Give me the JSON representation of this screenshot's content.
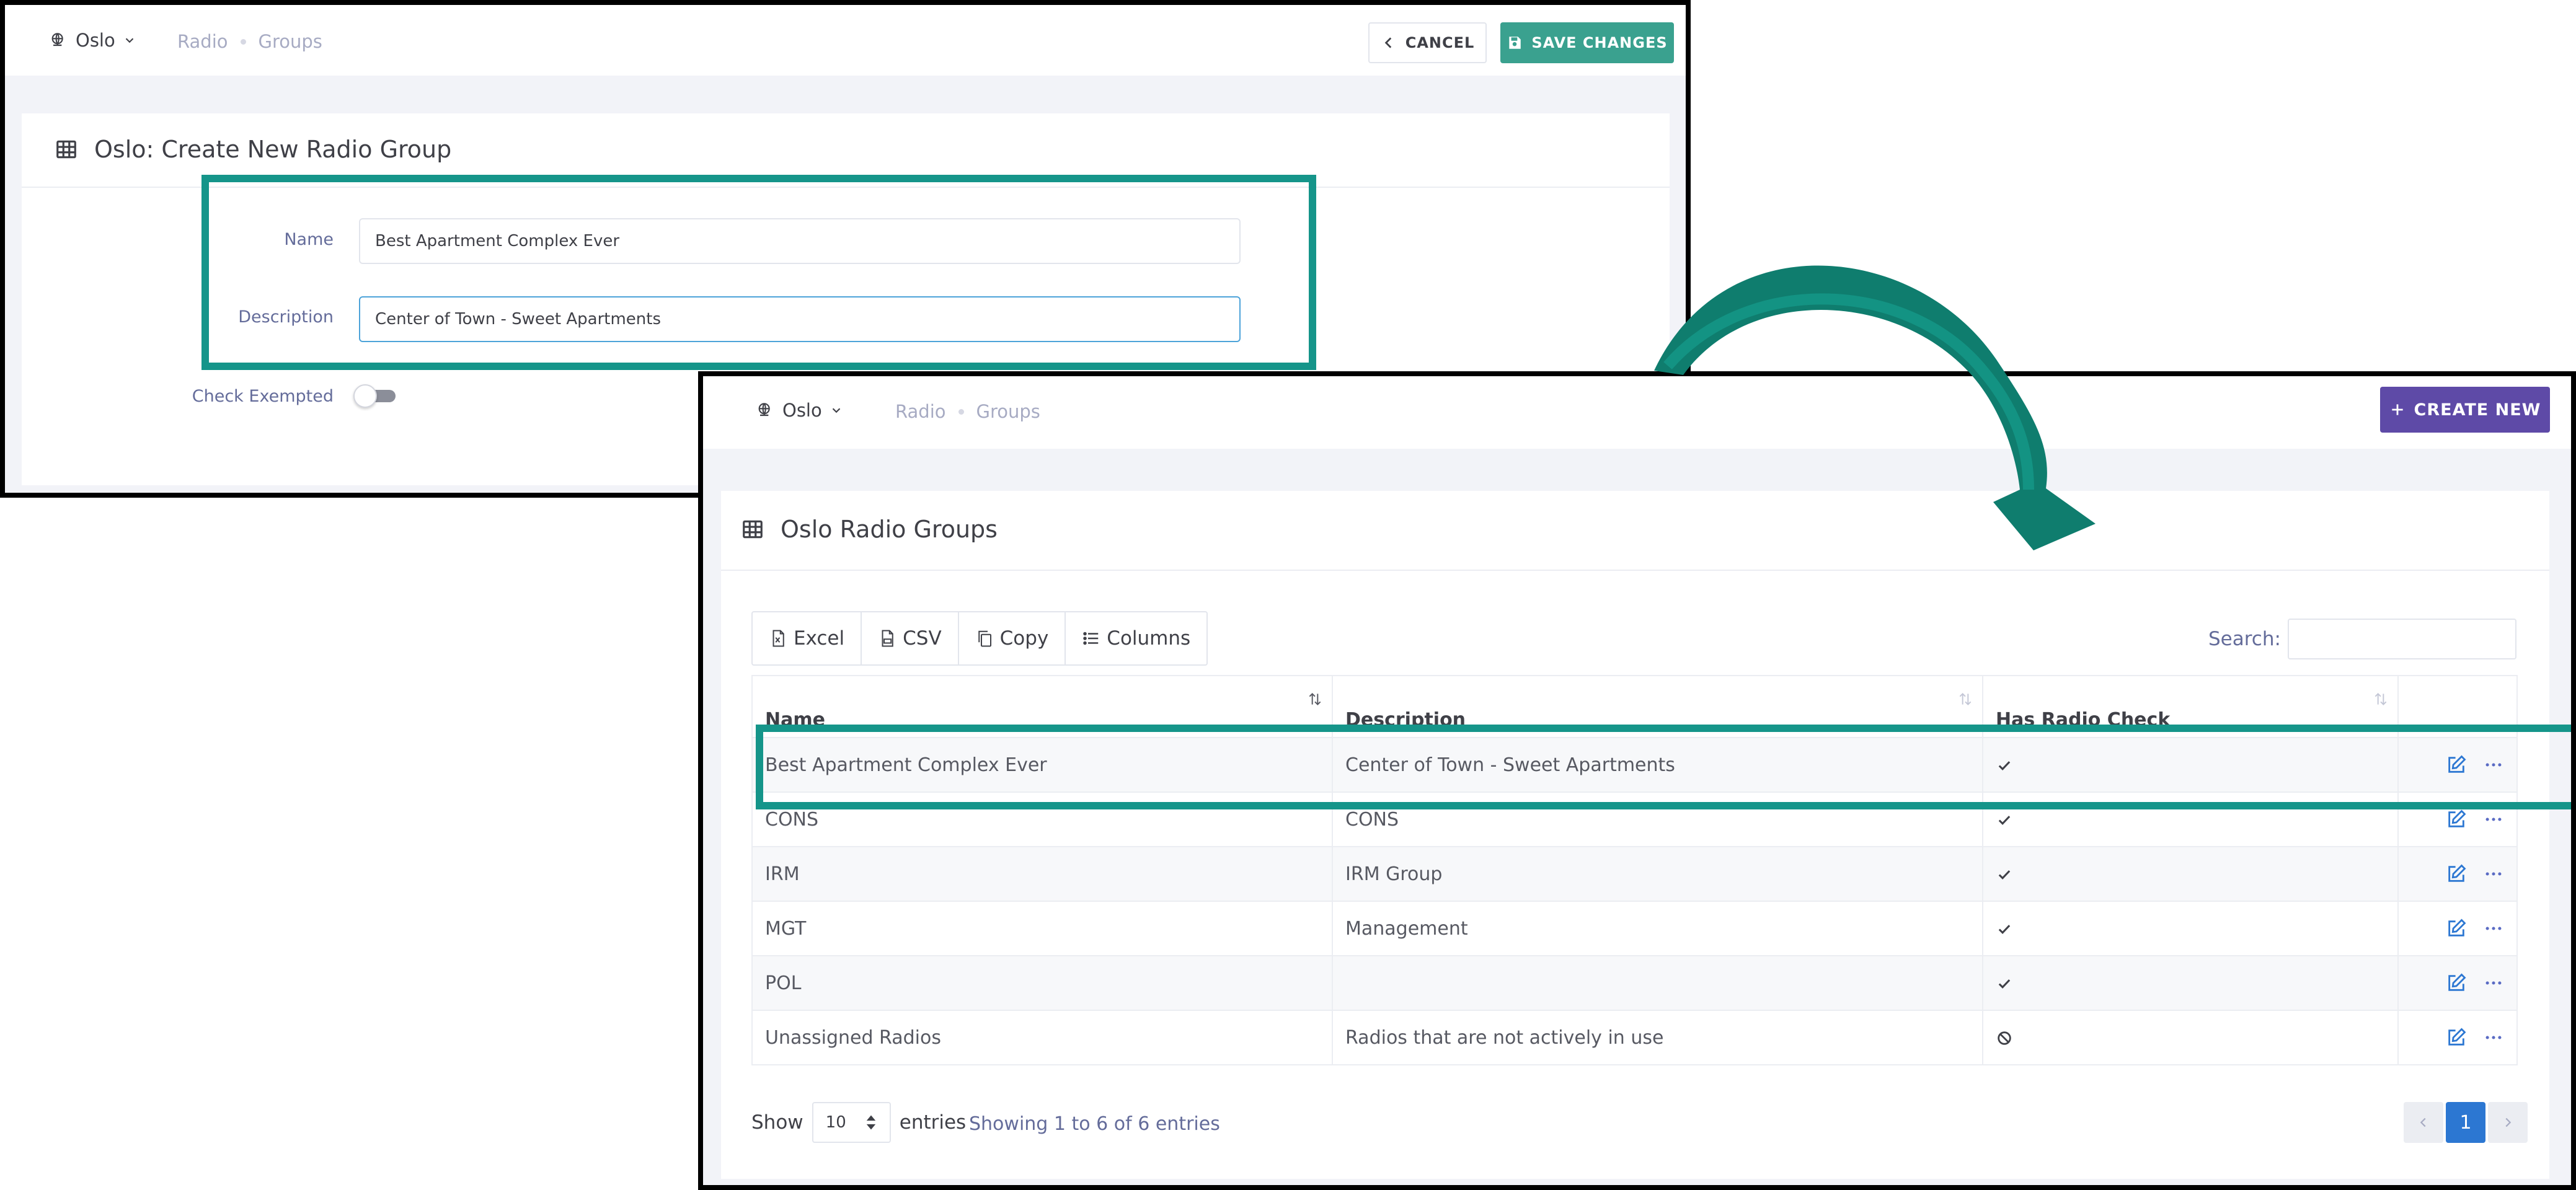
{
  "colors": {
    "highlight": "#15958a",
    "save": "#3aa18f",
    "create": "#5e4aa7",
    "page_active": "#2c77d2"
  },
  "create_screen": {
    "tenant": "Oslo",
    "breadcrumb": [
      "Radio",
      "Groups"
    ],
    "cancel_label": "CANCEL",
    "save_label": "SAVE CHANGES",
    "title": "Oslo: Create New Radio Group",
    "form": {
      "name_label": "Name",
      "name_value": "Best Apartment Complex Ever",
      "description_label": "Description",
      "description_value": "Center of Town - Sweet Apartments",
      "check_exempted_label": "Check Exempted",
      "check_exempted_on": false
    }
  },
  "list_screen": {
    "tenant": "Oslo",
    "breadcrumb": [
      "Radio",
      "Groups"
    ],
    "create_label": "CREATE NEW",
    "title": "Oslo Radio Groups",
    "export_buttons": [
      {
        "label": "Excel",
        "icon": "excel-file-icon"
      },
      {
        "label": "CSV",
        "icon": "csv-file-icon"
      },
      {
        "label": "Copy",
        "icon": "copy-icon"
      },
      {
        "label": "Columns",
        "icon": "list-icon"
      }
    ],
    "search_label": "Search:",
    "search_value": "",
    "columns": [
      "Name",
      "Description",
      "Has Radio Check",
      ""
    ],
    "rows": [
      {
        "name": "Best Apartment Complex Ever",
        "description": "Center of Town - Sweet Apartments",
        "has_radio_check": "check-icon"
      },
      {
        "name": "CONS",
        "description": "CONS",
        "has_radio_check": "check-icon"
      },
      {
        "name": "IRM",
        "description": "IRM Group",
        "has_radio_check": "check-icon"
      },
      {
        "name": "MGT",
        "description": "Management",
        "has_radio_check": "check-icon"
      },
      {
        "name": "POL",
        "description": "",
        "has_radio_check": "check-icon"
      },
      {
        "name": "Unassigned Radios",
        "description": "Radios that are not actively in use",
        "has_radio_check": "ban-icon"
      }
    ],
    "show_label": "Show",
    "page_length": "10",
    "entries_label": "entries",
    "info": "Showing 1 to 6 of 6 entries",
    "current_page": "1"
  }
}
